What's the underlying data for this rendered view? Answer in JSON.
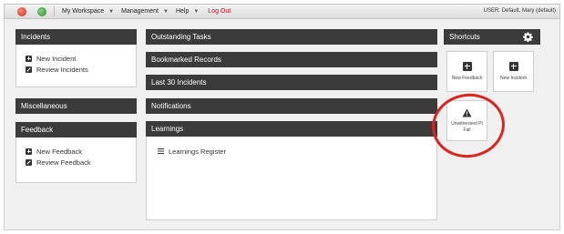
{
  "topbar": {
    "workspace_label": "My Workspace",
    "management_label": "Management",
    "help_label": "Help",
    "logout_label": "Log Out",
    "user_text": "USER: Default, Mary (default)"
  },
  "left": {
    "incidents": {
      "title": "Incidents",
      "items": [
        {
          "label": "New Incident",
          "icon": "plus-square-icon"
        },
        {
          "label": "Review Incidents",
          "icon": "edit-square-icon"
        }
      ]
    },
    "miscellaneous": {
      "title": "Miscellaneous"
    },
    "feedback": {
      "title": "Feedback",
      "items": [
        {
          "label": "New Feedback",
          "icon": "plus-square-icon"
        },
        {
          "label": "Review Feedback",
          "icon": "edit-square-icon"
        }
      ]
    }
  },
  "center": {
    "outstanding_tasks": "Outstanding Tasks",
    "bookmarked_records": "Bookmarked Records",
    "last_30_incidents": "Last 30 Incidents",
    "notifications": "Notifications",
    "learnings": {
      "title": "Learnings",
      "items": [
        {
          "label": "Learnings Register",
          "icon": "list-icon"
        }
      ]
    }
  },
  "shortcuts": {
    "title": "Shortcuts",
    "tiles": [
      {
        "label": "New Feedback",
        "icon": "plus-square-icon"
      },
      {
        "label": "New Incident",
        "icon": "plus-square-icon"
      },
      {
        "label": "Unwitnessed Pt Fall",
        "icon": "warning-icon"
      }
    ]
  },
  "colors": {
    "panel_header": "#3b3b3b",
    "highlight_ring": "#d9261c",
    "logout": "#d0021b"
  }
}
